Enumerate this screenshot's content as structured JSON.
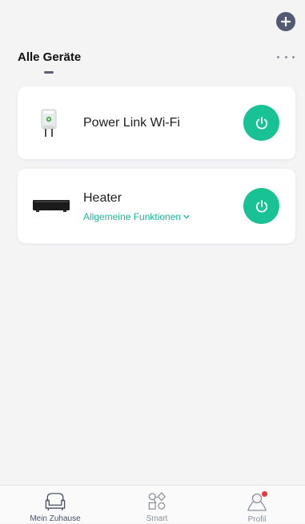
{
  "header": {
    "title": "Alle Geräte",
    "add_icon": "plus-circle-icon",
    "more_icon": "more-dots-icon"
  },
  "devices": [
    {
      "name": "Power Link Wi-Fi",
      "icon": "smart-plug-image",
      "power_icon": "power-icon"
    },
    {
      "name": "Heater",
      "subtitle": "Allgemeine Funktionen",
      "icon": "heater-image",
      "power_icon": "power-icon"
    }
  ],
  "tabbar": {
    "items": [
      {
        "label": "Mein Zuhause",
        "icon": "armchair-icon",
        "active": true
      },
      {
        "label": "Smart",
        "icon": "shapes-icon",
        "active": false
      },
      {
        "label": "Profil",
        "icon": "profile-icon",
        "active": false,
        "badge": true
      }
    ]
  },
  "colors": {
    "accent": "#18c295",
    "accent_text": "#18b899",
    "header_button": "#525a73",
    "badge": "#f0353c",
    "background": "#f4f4f5"
  }
}
